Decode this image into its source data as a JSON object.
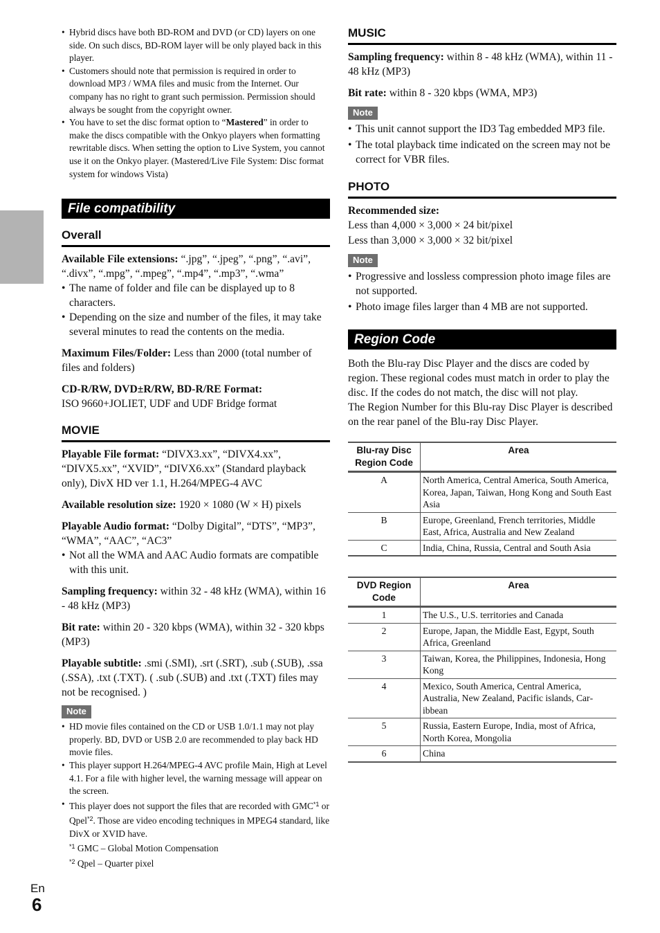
{
  "intro_bullets": [
    "Hybrid discs have both BD-ROM and DVD (or CD) layers on one side. On such discs, BD-ROM layer will be only played back in this player.",
    "Customers should note that permission is required in order to download MP3 / WMA files and music from the Internet. Our company has no right to grant such permission. Permission should always be sought from the copyright owner."
  ],
  "intro_mastered": {
    "before": "You have to set the disc format option to “",
    "bold": "Mastered",
    "after": "” in order to make the discs compatible with the Onkyo players when format­ting rewritable discs. When setting the option to Live System, you cannot use it on the Onkyo player. (Mastered/Live File Sys­tem: Disc format system for windows Vista)"
  },
  "file_compat": {
    "title": "File compatibility",
    "overall": {
      "heading": "Overall",
      "ext_label": "Available File extensions:",
      "ext_value": " “.jpg”, “.jpeg”, “.png”, “.avi”, “.divx”, “.mpg”, “.mpeg”, “.mp4”, “.mp3”, “.wma”",
      "bullets": [
        "The name of folder and file can be displayed up to 8 characters.",
        "Depending on the size and number of the files, it may take several minutes to read the contents on the media."
      ],
      "max_label": "Maximum Files/Folder:",
      "max_value": " Less than 2000 (total number of files and folders)",
      "format_label": "CD-R/RW, DVD±R/RW, BD-R/RE Format:",
      "format_value": "ISO 9660+JOLIET, UDF and UDF Bridge format"
    },
    "movie": {
      "heading": "MOVIE",
      "file_format_label": "Playable File format:",
      "file_format_value": " “DIVX3.xx”, “DIVX4.xx”, “DIVX5.xx”, “XVID”, “DIVX6.xx” (Standard playback only), DivX HD ver 1.1, H.264/MPEG-4 AVC",
      "resolution_label": "Available resolution size:",
      "resolution_value": " 1920 × 1080 (W × H) pixels",
      "audio_label": "Playable Audio format:",
      "audio_value": " “Dolby Digital”, “DTS”, “MP3”, “WMA”, “AAC”, “AC3”",
      "audio_bullets": [
        "Not all the WMA and AAC Audio formats are compati­ble with this unit."
      ],
      "sampling_label": "Sampling frequency:",
      "sampling_value": " within 32 - 48 kHz (WMA), within 16 - 48 kHz (MP3)",
      "bitrate_label": "Bit rate:",
      "bitrate_value": " within 20 - 320 kbps (WMA), within 32 - 320 kbps (MP3)",
      "subtitle_label": "Playable subtitle:",
      "subtitle_value": " .smi (.SMI), .srt (.SRT), .sub (.SUB), .ssa (.SSA), .txt (.TXT). ( .sub (.SUB) and .txt (.TXT) files may not be recognised. )",
      "note_label": "Note",
      "note_bullets": [
        "HD movie files contained on the CD or USB 1.0/1.1 may not play properly. BD, DVD or USB 2.0 are recommended to play back HD movie files.",
        "This player support H.264/MPEG-4 AVC profile Main, High at Level 4.1. For a file with higher level, the warning message will appear on the screen."
      ],
      "gmc_note": {
        "before": "This player does not support the files that are recorded with GMC",
        "sup1": "*1",
        "middle": " or Qpel",
        "sup2": "*2",
        "after": ". Those are video encoding techniques in MPEG4 standard, like DivX or XVID have."
      },
      "footnotes": [
        {
          "mark": "*1",
          "text": " GMC – Global Motion Compensation"
        },
        {
          "mark": "*2",
          "text": " Qpel – Quarter pixel"
        }
      ]
    }
  },
  "music": {
    "heading": "MUSIC",
    "sampling_label": "Sampling frequency:",
    "sampling_value": " within 8 - 48 kHz (WMA), within 11 - 48 kHz (MP3)",
    "bitrate_label": "Bit rate:",
    "bitrate_value": " within 8 - 320 kbps (WMA, MP3)",
    "note_label": "Note",
    "note_bullets": [
      "This unit cannot support the ID3 Tag embedded MP3 file.",
      "The total playback time indicated on the screen may not be correct for VBR files."
    ]
  },
  "photo": {
    "heading": "PHOTO",
    "size_label": "Recommended size:",
    "size_lines": [
      "Less than 4,000 × 3,000 × 24 bit/pixel",
      "Less than 3,000 × 3,000 × 32 bit/pixel"
    ],
    "note_label": "Note",
    "note_bullets": [
      "Progressive and lossless compression photo image files are not supported.",
      "Photo image files larger than 4 MB are not supported."
    ]
  },
  "region": {
    "title": "Region Code",
    "description": "Both the Blu-ray Disc Player and the discs are coded by region. These regional codes must match in order to play the disc. If the codes do not match, the disc will not play.",
    "description2": "The Region Number for this Blu-ray Disc Player is described on the rear panel of the Blu-ray Disc Player.",
    "bd_table": {
      "headers": [
        "Blu-ray Disc Region Code",
        "Area"
      ],
      "rows": [
        [
          "A",
          "North America, Central America, South America, Korea, Japan, Taiwan, Hong Kong and South East Asia"
        ],
        [
          "B",
          "Europe, Greenland, French territories, Middle East, Africa, Australia and New Zealand"
        ],
        [
          "C",
          "India, China, Russia, Central and South Asia"
        ]
      ]
    },
    "dvd_table": {
      "headers": [
        "DVD Region Code",
        "Area"
      ],
      "rows": [
        [
          "1",
          "The U.S., U.S. territories and Canada"
        ],
        [
          "2",
          "Europe, Japan, the Middle East, Egypt, South Africa, Greenland"
        ],
        [
          "3",
          "Taiwan, Korea, the Philippines, Indonesia, Hong Kong"
        ],
        [
          "4",
          "Mexico, South America, Central America, Australia, New Zealand, Pacific islands, Car­ibbean"
        ],
        [
          "5",
          "Russia, Eastern Europe, India, most of Africa, North Korea, Mongolia"
        ],
        [
          "6",
          "China"
        ]
      ]
    }
  },
  "footer": {
    "language": "En",
    "page_number": "6"
  }
}
